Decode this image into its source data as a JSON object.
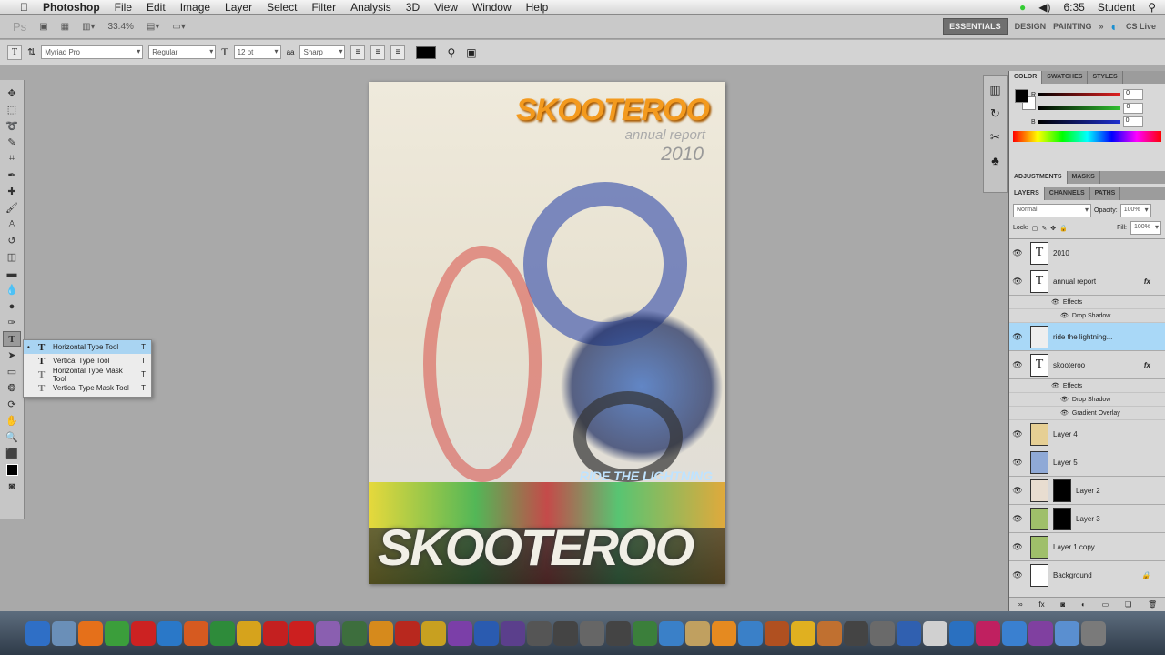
{
  "menubar": {
    "app": "Photoshop",
    "items": [
      "File",
      "Edit",
      "Image",
      "Layer",
      "Select",
      "Filter",
      "Analysis",
      "3D",
      "View",
      "Window",
      "Help"
    ],
    "time": "6:35",
    "user": "Student"
  },
  "appbar": {
    "logo": "Ps",
    "zoom": "33.4%",
    "workspaces": [
      "ESSENTIALS",
      "DESIGN",
      "PAINTING"
    ],
    "more": "»",
    "cslive": "CS Live"
  },
  "options": {
    "font_family": "Myriad Pro",
    "font_style": "Regular",
    "font_size": "12 pt",
    "aa_label": "aa",
    "antialias": "Sharp"
  },
  "tools_flyout": [
    {
      "icon": "T",
      "label": "Horizontal Type Tool",
      "key": "T",
      "selected": true
    },
    {
      "icon": "T",
      "label": "Vertical Type Tool",
      "key": "T"
    },
    {
      "icon": "T",
      "label": "Horizontal Type Mask Tool",
      "key": "T"
    },
    {
      "icon": "T",
      "label": "Vertical Type Mask Tool",
      "key": "T"
    }
  ],
  "poster": {
    "title": "SKOOTEROO",
    "subtitle": "annual report",
    "year": "2010",
    "tagline": "RIDE THE LIGHTNING",
    "bottom": "SKOOTEROO"
  },
  "color_panel": {
    "tabs": [
      "COLOR",
      "SWATCHES",
      "STYLES"
    ],
    "r_label": "R",
    "g_label": "G",
    "b_label": "B",
    "r": "0",
    "g": "0",
    "b": "0"
  },
  "adjust_tabs": [
    "ADJUSTMENTS",
    "MASKS"
  ],
  "layers_panel": {
    "tabs": [
      "LAYERS",
      "CHANNELS",
      "PATHS"
    ],
    "blend": "Normal",
    "opacity_label": "Opacity:",
    "opacity": "100%",
    "lock_label": "Lock:",
    "fill_label": "Fill:",
    "fill": "100%",
    "layers": [
      {
        "name": "2010",
        "type": "text"
      },
      {
        "name": "annual report",
        "type": "text",
        "fx": "fx",
        "effects": [
          "Effects",
          "Drop Shadow"
        ]
      },
      {
        "name": "ride the lightning...",
        "type": "image",
        "selected": true
      },
      {
        "name": "skooteroo",
        "type": "text",
        "fx": "fx",
        "effects": [
          "Effects",
          "Drop Shadow",
          "Gradient Overlay"
        ]
      },
      {
        "name": "Layer 4",
        "type": "image",
        "color": "#e6cf94"
      },
      {
        "name": "Layer 5",
        "type": "image",
        "color": "#8fa9d6"
      },
      {
        "name": "Layer 2",
        "type": "mask",
        "color": "#e8ddd0"
      },
      {
        "name": "Layer 3",
        "type": "mask",
        "color": "#9fbf6a"
      },
      {
        "name": "Layer 1 copy",
        "type": "image",
        "color": "#9fbf6a"
      },
      {
        "name": "Background",
        "type": "image",
        "color": "#ffffff",
        "lock": "🔒"
      }
    ]
  },
  "dock": [
    "#2f6fc6",
    "#6a8fb8",
    "#e5701a",
    "#3b9e3b",
    "#cc2222",
    "#2a78c8",
    "#d65a20",
    "#2e8b3a",
    "#d6a31c",
    "#c42020",
    "#cc1f1f",
    "#8a5fb0",
    "#3d6e3d",
    "#d68a1c",
    "#b8281e",
    "#c8a020",
    "#7b3fa8",
    "#2a5bb0",
    "#5b3f8c",
    "#555555",
    "#444444",
    "#666666",
    "#444444",
    "#3b7f3b",
    "#3a80c8",
    "#c0a060",
    "#e58a20",
    "#3a80c8",
    "#b05020",
    "#e0b020",
    "#c07030",
    "#444444",
    "#6a6a6a",
    "#3060b0",
    "#d0d0d0",
    "#2a70c0",
    "#c02060",
    "#3a80d0",
    "#8040a0",
    "#5a8fd0",
    "#7a7a7a"
  ]
}
